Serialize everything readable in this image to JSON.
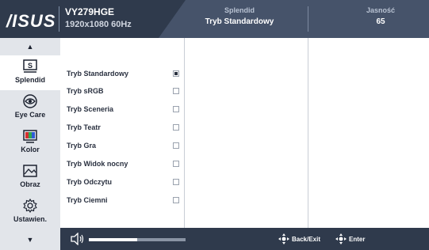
{
  "header": {
    "logo": "/ISUS",
    "model": "VY279HGE",
    "resolution": "1920x1080 60Hz",
    "section_a": {
      "label": "Splendid",
      "value": "Tryb Standardowy"
    },
    "section_b": {
      "label": "Jasność",
      "value": "65"
    }
  },
  "sidebar": {
    "items": [
      {
        "label": "Splendid",
        "icon": "splendid-icon"
      },
      {
        "label": "Eye Care",
        "icon": "eye-care-icon"
      },
      {
        "label": "Kolor",
        "icon": "color-icon"
      },
      {
        "label": "Obraz",
        "icon": "image-icon"
      },
      {
        "label": "Ustawien.",
        "icon": "settings-gear-icon"
      }
    ],
    "active": "Splendid"
  },
  "modes": [
    {
      "label": "Tryb Standardowy",
      "checked": true
    },
    {
      "label": "Tryb sRGB",
      "checked": false
    },
    {
      "label": "Tryb Sceneria",
      "checked": false
    },
    {
      "label": "Tryb Teatr",
      "checked": false
    },
    {
      "label": "Tryb Gra",
      "checked": false
    },
    {
      "label": "Tryb Widok nocny",
      "checked": false
    },
    {
      "label": "Tryb Odczytu",
      "checked": false
    },
    {
      "label": "Tryb Ciemni",
      "checked": false
    }
  ],
  "footer": {
    "volume_fraction": 0.5,
    "back_label": "Back/Exit",
    "enter_label": "Enter"
  },
  "colors": {
    "header_bg": "#2f3a4c",
    "header_panel": "#46536a",
    "sidebar_bg": "#e2e5ea",
    "active_bg": "#ffffff"
  }
}
